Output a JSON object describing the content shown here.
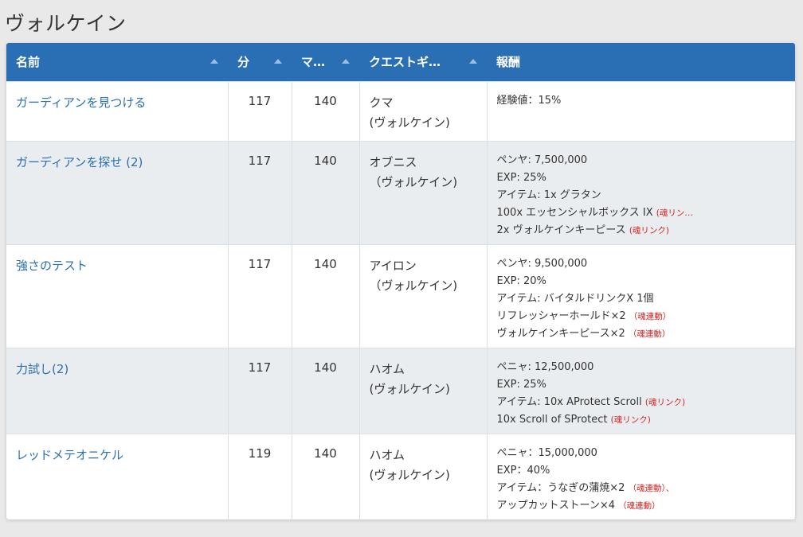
{
  "page_title": "ヴォルケイン",
  "headers": {
    "name": "名前",
    "min": "分",
    "max": "マ…",
    "giver": "クエストギ…",
    "reward": "報酬"
  },
  "rows": [
    {
      "name": "ガーディアンを見つける",
      "min": "117",
      "max": "140",
      "giver": [
        "クマ",
        "(ヴォルケイン)"
      ],
      "reward": [
        {
          "text": "経験値：15%",
          "tag": ""
        }
      ]
    },
    {
      "name": "ガーディアンを探せ (2)",
      "min": "117",
      "max": "140",
      "giver": [
        "オブニス",
        "（ヴォルケイン)"
      ],
      "reward": [
        {
          "text": "ペンヤ: 7,500,000",
          "tag": ""
        },
        {
          "text": "EXP: 25%",
          "tag": ""
        },
        {
          "text": "アイテム: 1x グラタン",
          "tag": ""
        },
        {
          "text": "100x エッセンシャルボックス IX ",
          "tag": "(魂リン…"
        },
        {
          "text": "2x ヴォルケインキーピース ",
          "tag": "(魂リンク)"
        }
      ]
    },
    {
      "name": "強さのテスト",
      "min": "117",
      "max": "140",
      "giver": [
        "アイロン",
        "（ヴォルケイン)"
      ],
      "reward": [
        {
          "text": "ペンヤ: 9,500,000",
          "tag": ""
        },
        {
          "text": "EXP: 20%",
          "tag": ""
        },
        {
          "text": "アイテム: バイタルドリンクX 1個",
          "tag": ""
        },
        {
          "text": "リフレッシャーホールド×2 ",
          "tag": "（魂連動）"
        },
        {
          "text": "ヴォルケインキーピース×2 ",
          "tag": "（魂連動）"
        }
      ]
    },
    {
      "name": "力試し(2)",
      "min": "117",
      "max": "140",
      "giver": [
        "ハオム",
        "(ヴォルケイン)"
      ],
      "reward": [
        {
          "text": "ペニャ: 12,500,000",
          "tag": ""
        },
        {
          "text": "EXP: 25%",
          "tag": ""
        },
        {
          "text": "アイテム: 10x AProtect Scroll ",
          "tag": "(魂リンク)"
        },
        {
          "text": "10x Scroll of SProtect ",
          "tag": "(魂リンク)"
        }
      ]
    },
    {
      "name": "レッドメテオニケル",
      "min": "119",
      "max": "140",
      "giver": [
        "ハオム",
        "(ヴォルケイン)"
      ],
      "reward": [
        {
          "text": "ペニャ：15,000,000",
          "tag": ""
        },
        {
          "text": "EXP：40%",
          "tag": ""
        },
        {
          "text": "アイテム：うなぎの蒲焼×2 ",
          "tag": "（魂連動）、"
        },
        {
          "text": "アップカットストーン×4 ",
          "tag": "（魂連動）"
        }
      ]
    }
  ]
}
